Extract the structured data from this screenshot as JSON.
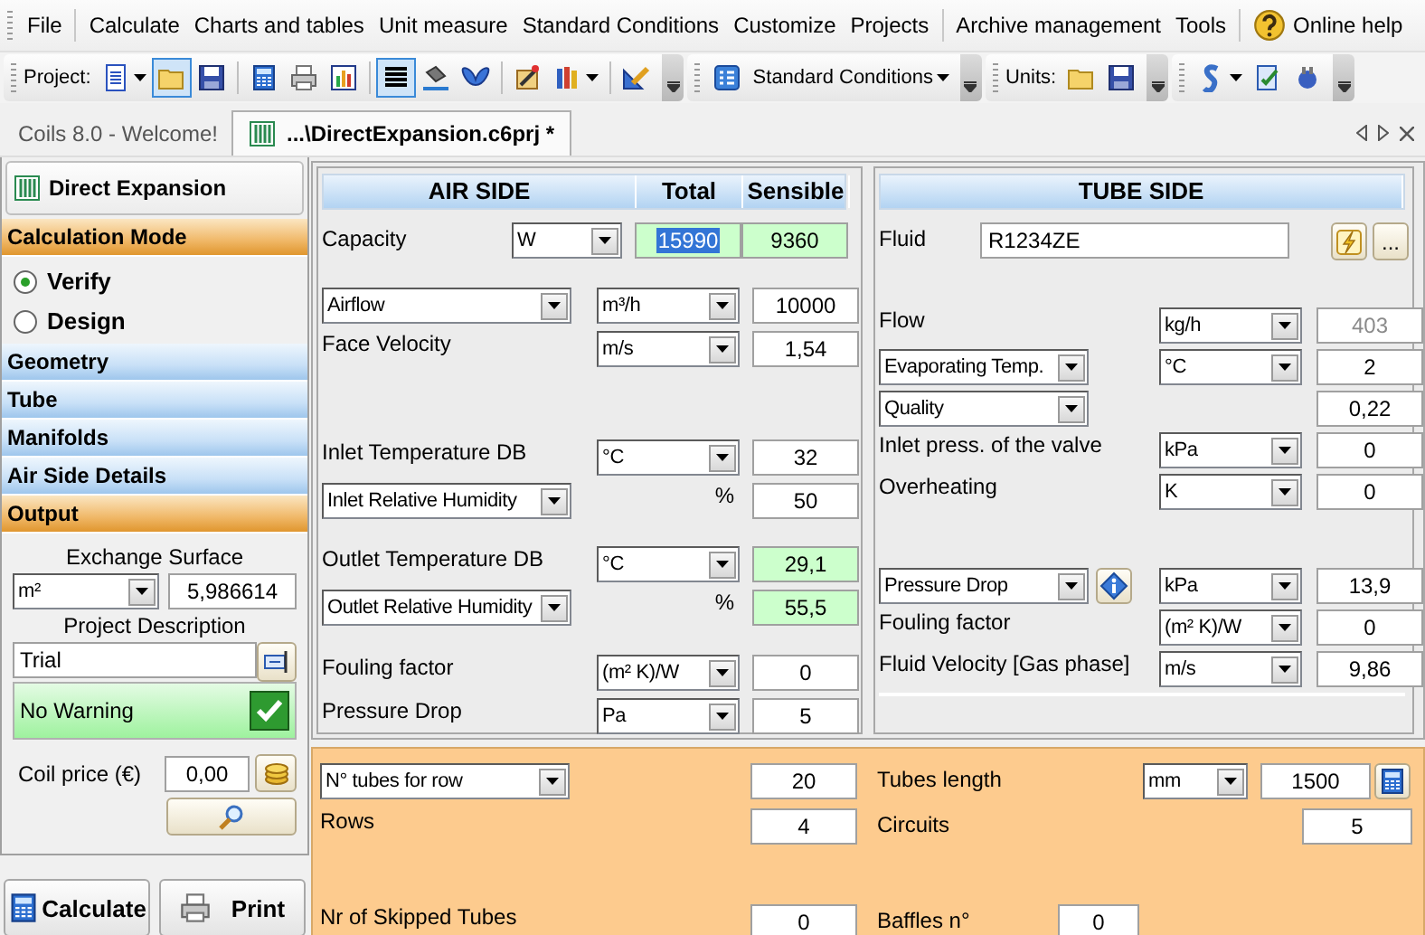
{
  "menu": [
    [
      {
        "label": "File",
        "kind": "text"
      }
    ],
    [
      {
        "label": "Calculate",
        "kind": "text"
      },
      {
        "label": "Charts and tables",
        "kind": "text"
      },
      {
        "label": "Unit measure",
        "kind": "text"
      },
      {
        "label": "Standard Conditions",
        "kind": "text"
      },
      {
        "label": "Customize",
        "kind": "text"
      },
      {
        "label": "Projects",
        "kind": "text"
      }
    ],
    [
      {
        "label": "Archive management",
        "kind": "text"
      },
      {
        "label": "Tools",
        "kind": "text"
      }
    ],
    [
      {
        "label": "Online help",
        "kind": "help"
      }
    ]
  ],
  "toolbars": [
    {
      "label": "Project:",
      "groups": [
        [
          {
            "kind": "document",
            "pressed": false,
            "dropdown": true
          },
          {
            "kind": "folder",
            "pressed": true,
            "dropdown": false
          },
          {
            "kind": "save",
            "pressed": false,
            "dropdown": false
          }
        ],
        [
          {
            "kind": "calculator",
            "pressed": false,
            "dropdown": false
          },
          {
            "kind": "printer",
            "pressed": false,
            "dropdown": false
          },
          {
            "kind": "chart",
            "pressed": false,
            "dropdown": false
          }
        ],
        [
          {
            "kind": "lines",
            "pressed": true,
            "dropdown": false
          },
          {
            "kind": "paint",
            "pressed": false,
            "dropdown": false
          },
          {
            "kind": "butterfly",
            "pressed": false,
            "dropdown": false
          }
        ],
        [
          {
            "kind": "wand",
            "pressed": false,
            "dropdown": false
          },
          {
            "kind": "books",
            "pressed": false,
            "dropdown": true
          }
        ],
        [
          {
            "kind": "ruler",
            "pressed": false,
            "dropdown": false
          }
        ]
      ]
    },
    {
      "groups": [
        [
          {
            "kind": "list",
            "pressed": false,
            "dropdown": false
          },
          {
            "kind": "text",
            "label": "Standard Conditions",
            "pressed": false,
            "dropdown": true
          }
        ]
      ]
    },
    {
      "label": "Units:",
      "groups": [
        [
          {
            "kind": "folder",
            "pressed": false,
            "dropdown": false
          },
          {
            "kind": "save",
            "pressed": false,
            "dropdown": false
          }
        ]
      ]
    },
    {
      "groups": [
        [
          {
            "kind": "scroll",
            "pressed": false,
            "dropdown": true
          },
          {
            "kind": "checklist",
            "pressed": false,
            "dropdown": false
          },
          {
            "kind": "plug",
            "pressed": false,
            "dropdown": false
          }
        ]
      ]
    }
  ],
  "tabs": [
    {
      "label": "Coils 8.0 - Welcome!",
      "kind": "start",
      "selected": false
    },
    {
      "label": "...\\DirectExpansion.c6prj *",
      "kind": "project",
      "selected": true
    }
  ],
  "sidebar": {
    "title": "Direct Expansion",
    "sections": [
      {
        "label": "Calculation Mode",
        "expanded": true,
        "options": [
          {
            "label": "Verify",
            "selected": true
          },
          {
            "label": "Design",
            "selected": false
          }
        ]
      },
      {
        "label": "Geometry",
        "expanded": false
      },
      {
        "label": "Tube",
        "expanded": false
      },
      {
        "label": "Manifolds",
        "expanded": false
      },
      {
        "label": "Air Side Details",
        "expanded": false
      },
      {
        "label": "Output",
        "expanded": true,
        "output": {
          "surface_label": "Exchange Surface",
          "surface_unit": "m²",
          "surface_value": "5,986614",
          "description_label": "Project Description",
          "description": "Trial",
          "warning": "No Warning",
          "warning_ok": true,
          "price_label": "Coil price (€)",
          "price": "0,00"
        }
      }
    ],
    "buttons": [
      {
        "kind": "calculate",
        "label": "Calculate"
      },
      {
        "kind": "print",
        "label": "Print"
      }
    ]
  },
  "air_side": {
    "columns": [
      "AIR SIDE",
      "Total",
      "Sensible"
    ],
    "capacity": {
      "label": "Capacity",
      "unit": "W",
      "total": "15990",
      "total_selected": true,
      "sensible": "9360",
      "computed": true
    },
    "groups": [
      [
        {
          "kind": "select",
          "label": "Airflow",
          "unit": {
            "kind": "select",
            "text": "m³/h"
          },
          "value": "10000",
          "computed": false
        },
        {
          "kind": "label",
          "label": "Face Velocity",
          "unit": {
            "kind": "select",
            "text": "m/s"
          },
          "value": "1,54",
          "computed": false
        }
      ],
      [
        {
          "kind": "label",
          "label": "Inlet Temperature DB",
          "unit": {
            "kind": "select",
            "text": "°C"
          },
          "value": "32",
          "computed": false
        },
        {
          "kind": "select",
          "label": "Inlet Relative Humidity",
          "unit": {
            "kind": "text",
            "text": "%"
          },
          "value": "50",
          "computed": false
        }
      ],
      [
        {
          "kind": "label",
          "label": "Outlet Temperature DB",
          "unit": {
            "kind": "select",
            "text": "°C"
          },
          "value": "29,1",
          "computed": true
        },
        {
          "kind": "select",
          "label": "Outlet Relative Humidity",
          "unit": {
            "kind": "text",
            "text": "%"
          },
          "value": "55,5",
          "computed": true
        }
      ],
      [
        {
          "kind": "label",
          "label": "Fouling factor",
          "unit": {
            "kind": "select",
            "text": "(m² K)/W"
          },
          "value": "0",
          "computed": false
        },
        {
          "kind": "label",
          "label": "Pressure Drop",
          "unit": {
            "kind": "select",
            "text": "Pa"
          },
          "value": "5",
          "computed": false
        }
      ]
    ]
  },
  "tube_side": {
    "title": "TUBE SIDE",
    "fluid": {
      "label": "Fluid",
      "value": "R1234ZE",
      "more_button": "..."
    },
    "groups": [
      [
        {
          "kind": "label",
          "label": "Flow",
          "unit": {
            "kind": "select",
            "text": "kg/h"
          },
          "value": "403",
          "disabled": true
        },
        {
          "kind": "select",
          "label": "Evaporating Temp.",
          "unit": {
            "kind": "select",
            "text": "°C"
          },
          "value": "2",
          "disabled": false
        },
        {
          "kind": "select",
          "label": "Quality",
          "value": "0,22",
          "disabled": false
        },
        {
          "kind": "label",
          "label": "Inlet press. of the valve",
          "unit": {
            "kind": "select",
            "text": "kPa"
          },
          "value": "0",
          "disabled": false
        },
        {
          "kind": "label",
          "label": "Overheating",
          "unit": {
            "kind": "select",
            "text": "K"
          },
          "value": "0",
          "disabled": false
        }
      ],
      [
        {
          "kind": "select-info",
          "label": "Pressure Drop",
          "unit": {
            "kind": "select",
            "text": "kPa"
          },
          "value": "13,9",
          "disabled": false
        },
        {
          "kind": "label",
          "label": "Fouling factor",
          "unit": {
            "kind": "select",
            "text": "(m² K)/W"
          },
          "value": "0",
          "disabled": false
        },
        {
          "kind": "label",
          "label": "Fluid Velocity [Gas phase]",
          "unit": {
            "kind": "select",
            "text": "m/s"
          },
          "value": "9,86",
          "disabled": false
        }
      ]
    ]
  },
  "coil": {
    "left": [
      {
        "kind": "select",
        "label": "N° tubes for row",
        "value": "20"
      },
      {
        "kind": "label",
        "label": "Rows",
        "value": "4"
      },
      {
        "kind": "label",
        "label": "Nr of Skipped Tubes",
        "value": "0"
      }
    ],
    "right": [
      {
        "kind": "label-calc",
        "label": "Tubes length",
        "unit": {
          "kind": "select",
          "text": "mm"
        },
        "value": "1500"
      },
      {
        "kind": "label",
        "label": "Circuits",
        "value": "5"
      },
      {
        "kind": "label",
        "label": "Baffles n°",
        "value": "0"
      }
    ]
  }
}
